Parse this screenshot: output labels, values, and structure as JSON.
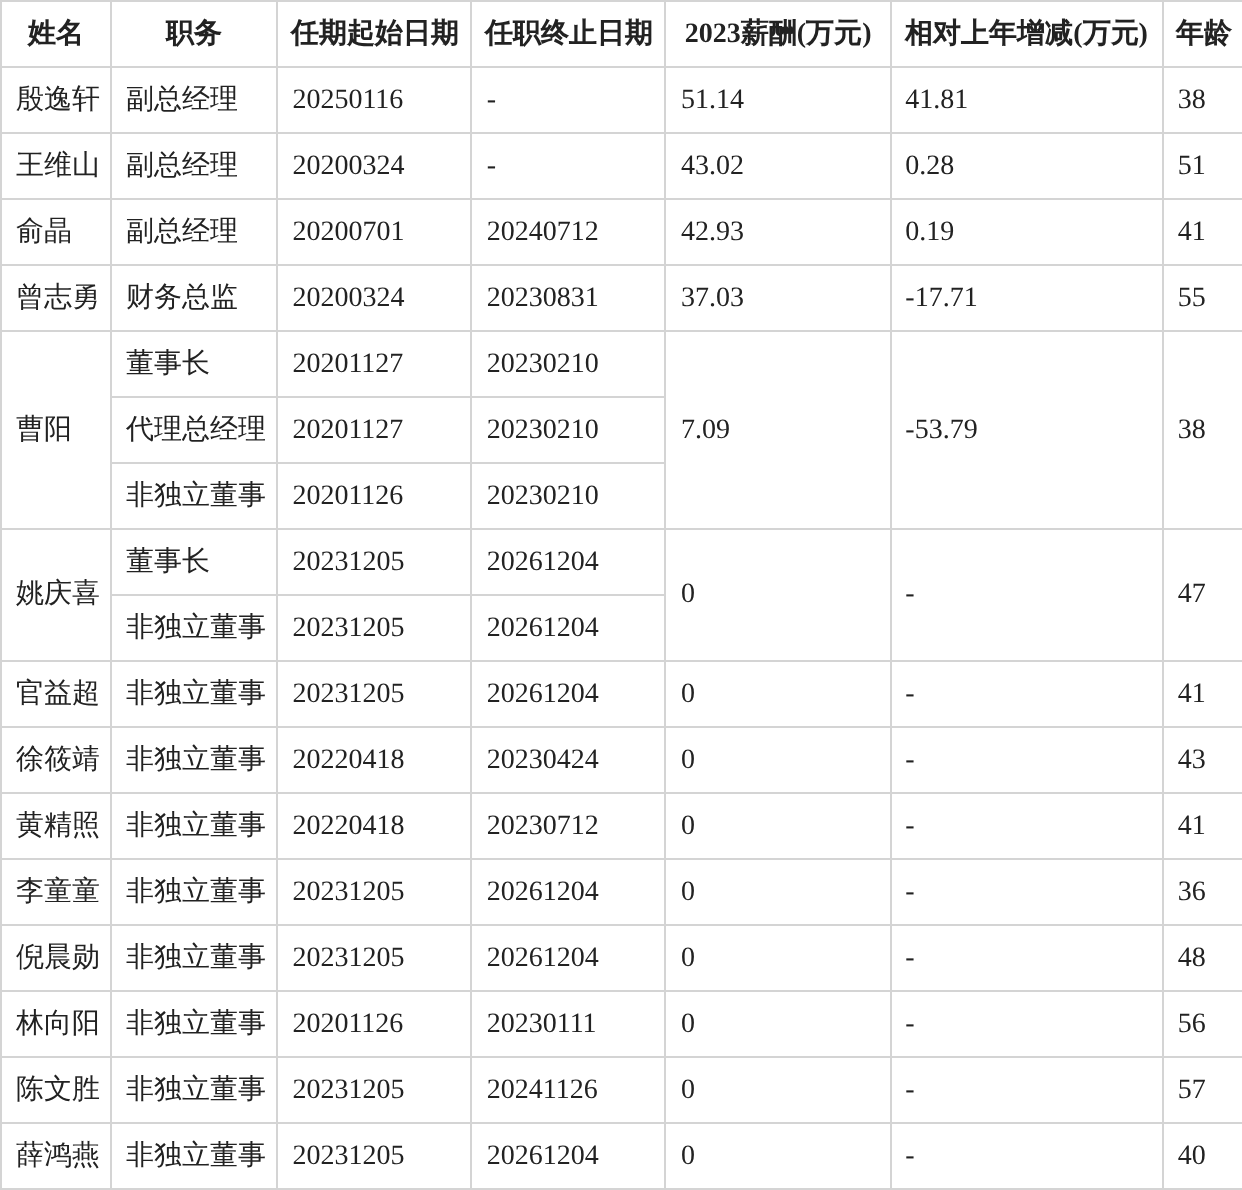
{
  "table": {
    "columns": [
      "姓名",
      "职务",
      "任期起始日期",
      "任职终止日期",
      "2023薪酬(万元)",
      "相对上年增减(万元)",
      "年龄"
    ],
    "rows": [
      {
        "name": "殷逸轩",
        "positions": [
          {
            "title": "副总经理",
            "start": "20250116",
            "end": "-"
          }
        ],
        "salary": "51.14",
        "change": "41.81",
        "age": "38"
      },
      {
        "name": "王维山",
        "positions": [
          {
            "title": "副总经理",
            "start": "20200324",
            "end": "-"
          }
        ],
        "salary": "43.02",
        "change": "0.28",
        "age": "51"
      },
      {
        "name": "俞晶",
        "positions": [
          {
            "title": "副总经理",
            "start": "20200701",
            "end": "20240712"
          }
        ],
        "salary": "42.93",
        "change": "0.19",
        "age": "41"
      },
      {
        "name": "曾志勇",
        "positions": [
          {
            "title": "财务总监",
            "start": "20200324",
            "end": "20230831"
          }
        ],
        "salary": "37.03",
        "change": "-17.71",
        "age": "55"
      },
      {
        "name": "曹阳",
        "positions": [
          {
            "title": "董事长",
            "start": "20201127",
            "end": "20230210"
          },
          {
            "title": "代理总经理",
            "start": "20201127",
            "end": "20230210"
          },
          {
            "title": "非独立董事",
            "start": "20201126",
            "end": "20230210"
          }
        ],
        "salary": "7.09",
        "change": "-53.79",
        "age": "38"
      },
      {
        "name": "姚庆喜",
        "positions": [
          {
            "title": "董事长",
            "start": "20231205",
            "end": "20261204"
          },
          {
            "title": "非独立董事",
            "start": "20231205",
            "end": "20261204"
          }
        ],
        "salary": "0",
        "change": "-",
        "age": "47"
      },
      {
        "name": "官益超",
        "positions": [
          {
            "title": "非独立董事",
            "start": "20231205",
            "end": "20261204"
          }
        ],
        "salary": "0",
        "change": "-",
        "age": "41"
      },
      {
        "name": "徐筱靖",
        "positions": [
          {
            "title": "非独立董事",
            "start": "20220418",
            "end": "20230424"
          }
        ],
        "salary": "0",
        "change": "-",
        "age": "43"
      },
      {
        "name": "黄精照",
        "positions": [
          {
            "title": "非独立董事",
            "start": "20220418",
            "end": "20230712"
          }
        ],
        "salary": "0",
        "change": "-",
        "age": "41"
      },
      {
        "name": "李童童",
        "positions": [
          {
            "title": "非独立董事",
            "start": "20231205",
            "end": "20261204"
          }
        ],
        "salary": "0",
        "change": "-",
        "age": "36"
      },
      {
        "name": "倪晨勋",
        "positions": [
          {
            "title": "非独立董事",
            "start": "20231205",
            "end": "20261204"
          }
        ],
        "salary": "0",
        "change": "-",
        "age": "48"
      },
      {
        "name": "林向阳",
        "positions": [
          {
            "title": "非独立董事",
            "start": "20201126",
            "end": "20230111"
          }
        ],
        "salary": "0",
        "change": "-",
        "age": "56"
      },
      {
        "name": "陈文胜",
        "positions": [
          {
            "title": "非独立董事",
            "start": "20231205",
            "end": "20241126"
          }
        ],
        "salary": "0",
        "change": "-",
        "age": "57"
      },
      {
        "name": "薛鸿燕",
        "positions": [
          {
            "title": "非独立董事",
            "start": "20231205",
            "end": "20261204"
          }
        ],
        "salary": "0",
        "change": "-",
        "age": "40"
      }
    ]
  }
}
